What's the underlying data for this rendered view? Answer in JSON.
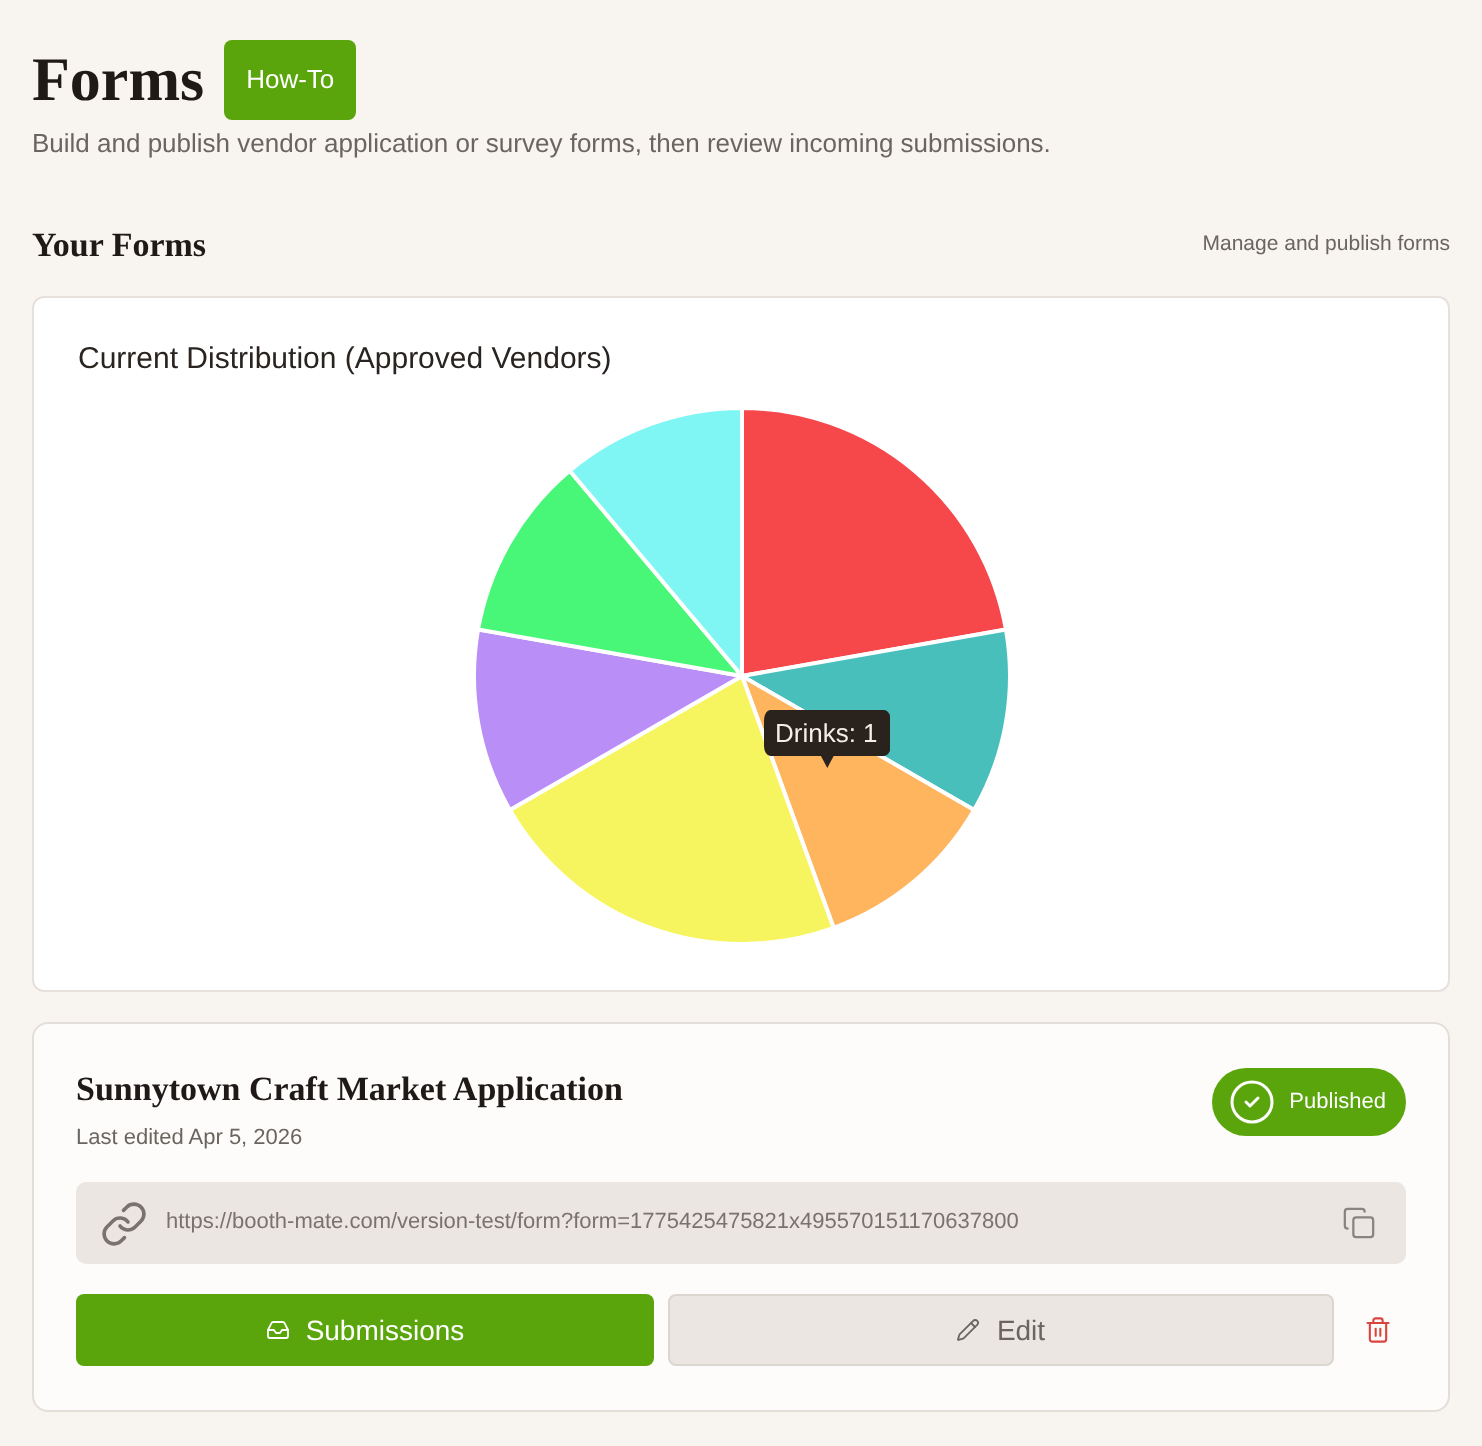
{
  "page": {
    "title": "Forms",
    "help_button": "How-To",
    "subtitle": "Build and publish vendor application or survey forms, then review incoming submissions."
  },
  "section": {
    "title": "Your Forms",
    "hint": "Manage and publish forms"
  },
  "chart": {
    "title": "Current Distribution (Approved Vendors)",
    "slices": [
      {
        "color": "#f6474b"
      },
      {
        "color": "#49bfbc"
      },
      {
        "color": "#ffb45e"
      },
      {
        "color": "#f7f55f"
      },
      {
        "color": "#b98ef7"
      },
      {
        "color": "#48f777"
      },
      {
        "color": "#80f6f4"
      }
    ],
    "tooltip": "Drinks: 1"
  },
  "forms": [
    {
      "title": "Sunnytown Craft Market Application",
      "last_edited": "Last edited Apr 5, 2026",
      "status": "Published",
      "url": "https://booth-mate.com/version-test/form?form=1775425475821x495570151170637800",
      "actions": [
        {
          "kind": "primary",
          "label": "Submissions"
        },
        {
          "kind": "secondary",
          "label": "Edit"
        }
      ]
    }
  ]
}
